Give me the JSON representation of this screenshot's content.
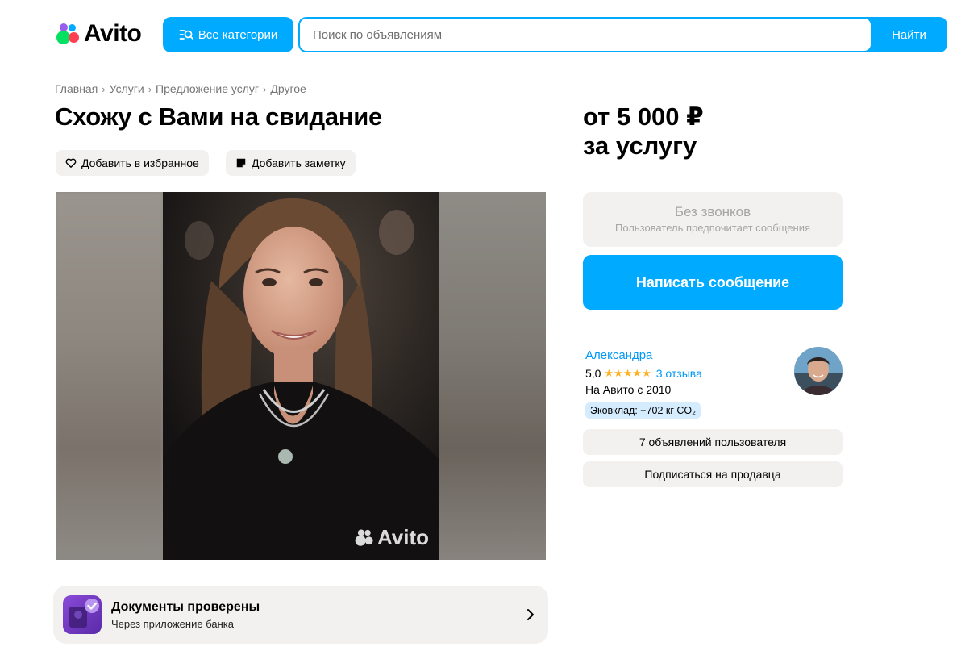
{
  "header": {
    "logo_text": "Avito",
    "categories_label": "Все категории",
    "search_placeholder": "Поиск по объявлениям",
    "search_value": "",
    "find_label": "Найти",
    "accent_color": "#00aaff"
  },
  "breadcrumb": {
    "items": [
      "Главная",
      "Услуги",
      "Предложение услуг",
      "Другое"
    ]
  },
  "listing": {
    "title": "Схожу с Вами на свидание",
    "favorite_label": "Добавить в избранное",
    "note_label": "Добавить заметку",
    "watermark": "Avito",
    "price_line1": "от 5 000 ₽",
    "price_line2": "за услугу"
  },
  "contact": {
    "no_calls_title": "Без звонков",
    "no_calls_sub": "Пользователь предпочитает сообщения",
    "message_label": "Написать сообщение"
  },
  "seller": {
    "name": "Александра",
    "rating": "5,0",
    "stars": 5,
    "reviews": "3 отзыва",
    "since": "На Авито с 2010",
    "eco": "Эковклад: −702 кг CO₂",
    "listings_label": "7 объявлений пользователя",
    "subscribe_label": "Подписаться на продавца"
  },
  "docs": {
    "title": "Документы проверены",
    "subtitle": "Через приложение банка"
  },
  "icons": {
    "categories": "search-list-icon",
    "favorite": "heart-icon",
    "note": "note-icon",
    "docs": "verified-badge-icon",
    "chevron": "chevron-right-icon"
  }
}
